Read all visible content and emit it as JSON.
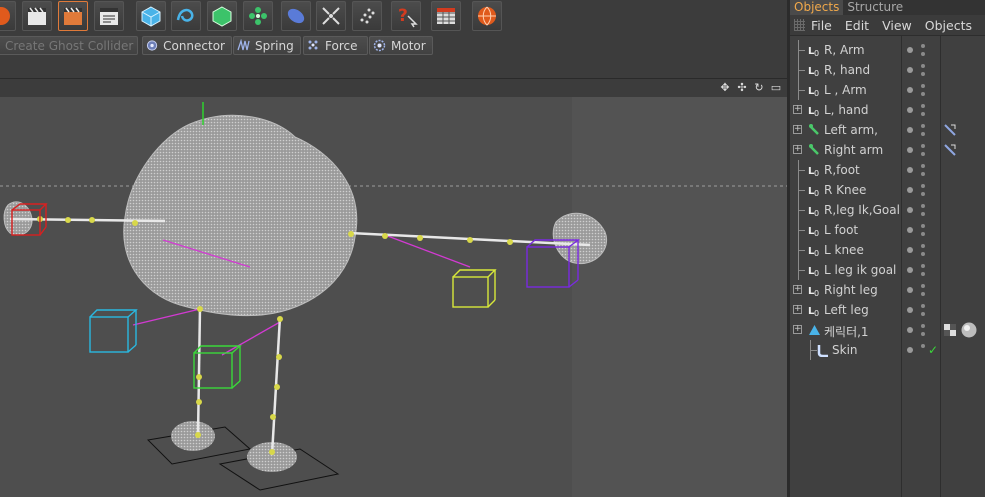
{
  "toolbar": {
    "icons": [
      {
        "name": "sphere-orange-icon",
        "color": "#e05a1c"
      },
      {
        "name": "clapper-icon",
        "color": "#e8e8e8"
      },
      {
        "name": "clapper-render-icon",
        "color": "#e07a3a"
      },
      {
        "name": "clapper-settings-icon",
        "color": "#e8e8e8"
      },
      {
        "name": "cube-primitive-icon",
        "color": "#49b3e8"
      },
      {
        "name": "spline-icon",
        "color": "#49b3e8"
      },
      {
        "name": "nurbs-icon",
        "color": "#3cc36a"
      },
      {
        "name": "array-icon",
        "color": "#3cc36a"
      },
      {
        "name": "deformer-icon",
        "color": "#5a7bd8"
      },
      {
        "name": "camera-icon",
        "color": "#dddddd"
      },
      {
        "name": "particles-icon",
        "color": "#dddddd"
      },
      {
        "name": "help-pointer-icon",
        "color": "#d23b1f"
      },
      {
        "name": "spreadsheet-icon",
        "color": "#dddddd"
      },
      {
        "name": "globe-icon",
        "color": "#e05a1c"
      }
    ]
  },
  "dynamics_toolbar": {
    "ghost_collider": "Create Ghost Collider",
    "connector": "Connector",
    "spring": "Spring",
    "force": "Force",
    "motor": "Motor"
  },
  "viewport": {
    "nav_icons": [
      "move-icon",
      "zoom-icon",
      "rotate-icon",
      "maximize-icon"
    ]
  },
  "object_manager": {
    "tabs": [
      "Objects",
      "Structure"
    ],
    "menu": [
      "File",
      "Edit",
      "View",
      "Objects"
    ],
    "objects": [
      {
        "label": "R, Arm",
        "icon": "null-icon",
        "expandable": false
      },
      {
        "label": "R, hand",
        "icon": "null-icon",
        "expandable": false
      },
      {
        "label": "L , Arm",
        "icon": "null-icon",
        "expandable": false
      },
      {
        "label": "L, hand",
        "icon": "null-icon",
        "expandable": true
      },
      {
        "label": "Left arm,",
        "icon": "bone-icon",
        "expandable": true,
        "tag": true
      },
      {
        "label": "Right arm",
        "icon": "bone-icon",
        "expandable": true,
        "tag": true
      },
      {
        "label": "R,foot",
        "icon": "null-icon",
        "expandable": false
      },
      {
        "label": "R Knee",
        "icon": "null-icon",
        "expandable": false
      },
      {
        "label": "R,leg Ik,Goal",
        "icon": "null-icon",
        "expandable": false
      },
      {
        "label": "L foot",
        "icon": "null-icon",
        "expandable": false
      },
      {
        "label": "L knee",
        "icon": "null-icon",
        "expandable": false
      },
      {
        "label": "L leg ik goal",
        "icon": "null-icon",
        "expandable": false
      },
      {
        "label": "Right leg",
        "icon": "null-icon",
        "expandable": true
      },
      {
        "label": "Left leg",
        "icon": "null-icon",
        "expandable": true
      },
      {
        "label": "케릭터,1",
        "icon": "polygon-object-icon",
        "expandable": true,
        "tags": [
          "checker-tag-icon",
          "material-tag-icon"
        ]
      },
      {
        "label": "Skin",
        "icon": "skin-deformer-icon",
        "expandable": false,
        "check": true
      }
    ]
  }
}
